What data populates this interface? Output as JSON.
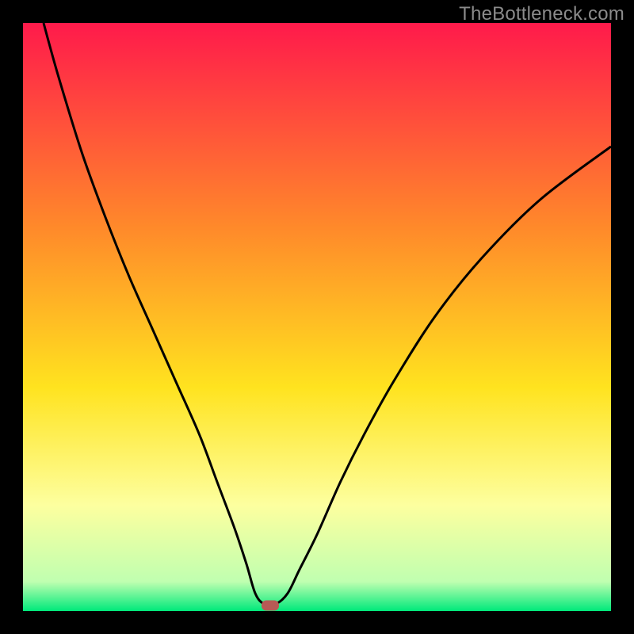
{
  "watermark": "TheBottleneck.com",
  "colors": {
    "frame": "#000000",
    "gradient_top": "#ff1a4b",
    "gradient_mid_upper": "#ff8a2a",
    "gradient_mid": "#ffe31f",
    "gradient_mid_lower": "#fdff9f",
    "gradient_bottom": "#00e97b",
    "curve": "#000000",
    "marker": "#b65a55"
  },
  "chart_data": {
    "type": "line",
    "title": "",
    "xlabel": "",
    "ylabel": "",
    "xlim": [
      0,
      100
    ],
    "ylim": [
      0,
      100
    ],
    "grid": false,
    "marker": {
      "x": 42,
      "y": 1
    },
    "series": [
      {
        "name": "curve",
        "x": [
          3.5,
          6,
          10,
          14,
          18,
          22,
          26,
          30,
          33,
          36,
          38,
          39.5,
          41,
          43,
          45,
          47,
          50,
          54,
          58,
          63,
          70,
          78,
          88,
          100
        ],
        "values": [
          100,
          91,
          78,
          67,
          57,
          48,
          39,
          30,
          22,
          14,
          8,
          3,
          1.2,
          1.2,
          3,
          7,
          13,
          22,
          30,
          39,
          50,
          60,
          70,
          79
        ]
      }
    ],
    "gradient_stops": [
      {
        "pct": 0,
        "color": "#ff1a4b"
      },
      {
        "pct": 35,
        "color": "#ff8a2a"
      },
      {
        "pct": 62,
        "color": "#ffe31f"
      },
      {
        "pct": 82,
        "color": "#fdff9f"
      },
      {
        "pct": 95,
        "color": "#c0ffb0"
      },
      {
        "pct": 100,
        "color": "#00e97b"
      }
    ]
  }
}
